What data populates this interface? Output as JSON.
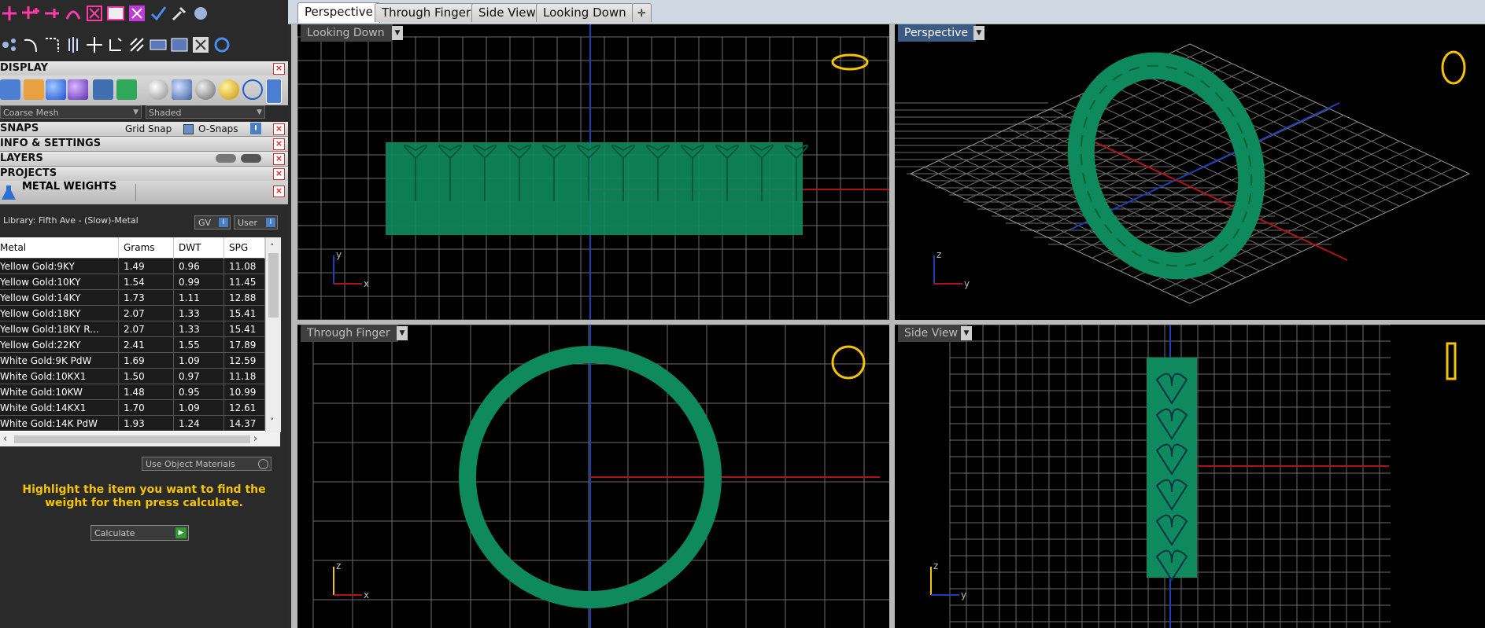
{
  "panel": {
    "display_title": "DISPLAY",
    "mesh_option": "Coarse Mesh",
    "render_option": "Shaded",
    "snaps_title": "SNAPS",
    "grid_snap_label": "Grid Snap",
    "osnaps_label": "O-Snaps",
    "info_title": "INFO & SETTINGS",
    "layers_title": "LAYERS",
    "projects_title": "PROJECTS",
    "metal_weights_title": "METAL WEIGHTS",
    "library_text": "Library: Fifth Ave - (Slow)-Metal",
    "gv_label": "GV",
    "user_label": "User",
    "use_object_materials": "Use Object Materials",
    "hint": "Highlight the item you want to find the weight for then press calculate.",
    "calculate_label": "Calculate"
  },
  "table": {
    "headers": [
      "Metal",
      "Grams",
      "DWT",
      "SPG"
    ],
    "rows": [
      [
        "Yellow Gold:9KY",
        "1.49",
        "0.96",
        "11.08"
      ],
      [
        "Yellow Gold:10KY",
        "1.54",
        "0.99",
        "11.45"
      ],
      [
        "Yellow Gold:14KY",
        "1.73",
        "1.11",
        "12.88"
      ],
      [
        "Yellow Gold:18KY",
        "2.07",
        "1.33",
        "15.41"
      ],
      [
        "Yellow Gold:18KY R...",
        "2.07",
        "1.33",
        "15.41"
      ],
      [
        "Yellow Gold:22KY",
        "2.41",
        "1.55",
        "17.89"
      ],
      [
        "White Gold:9K PdW",
        "1.69",
        "1.09",
        "12.59"
      ],
      [
        "White Gold:10KX1",
        "1.50",
        "0.97",
        "11.18"
      ],
      [
        "White Gold:10KW",
        "1.48",
        "0.95",
        "10.99"
      ],
      [
        "White Gold:14KX1",
        "1.70",
        "1.09",
        "12.61"
      ],
      [
        "White Gold:14K PdW",
        "1.93",
        "1.24",
        "14.37"
      ]
    ]
  },
  "tabs": [
    "Perspective",
    "Through Finger",
    "Side View",
    "Looking Down"
  ],
  "add_tab_icon": "plus-tab-icon",
  "viewports": {
    "top_left": "Looking Down",
    "top_right": "Perspective",
    "bottom_left": "Through Finger",
    "bottom_right": "Side View"
  },
  "axes": {
    "x": "x",
    "y": "y",
    "z": "z"
  },
  "colors": {
    "model_green": "#0f8a5e",
    "grid": "#6b6b6b",
    "axis_red": "#b01515",
    "axis_blue": "#1f3fb8",
    "highlight_yellow": "#f5c400",
    "active_label": "#3c5b84"
  }
}
